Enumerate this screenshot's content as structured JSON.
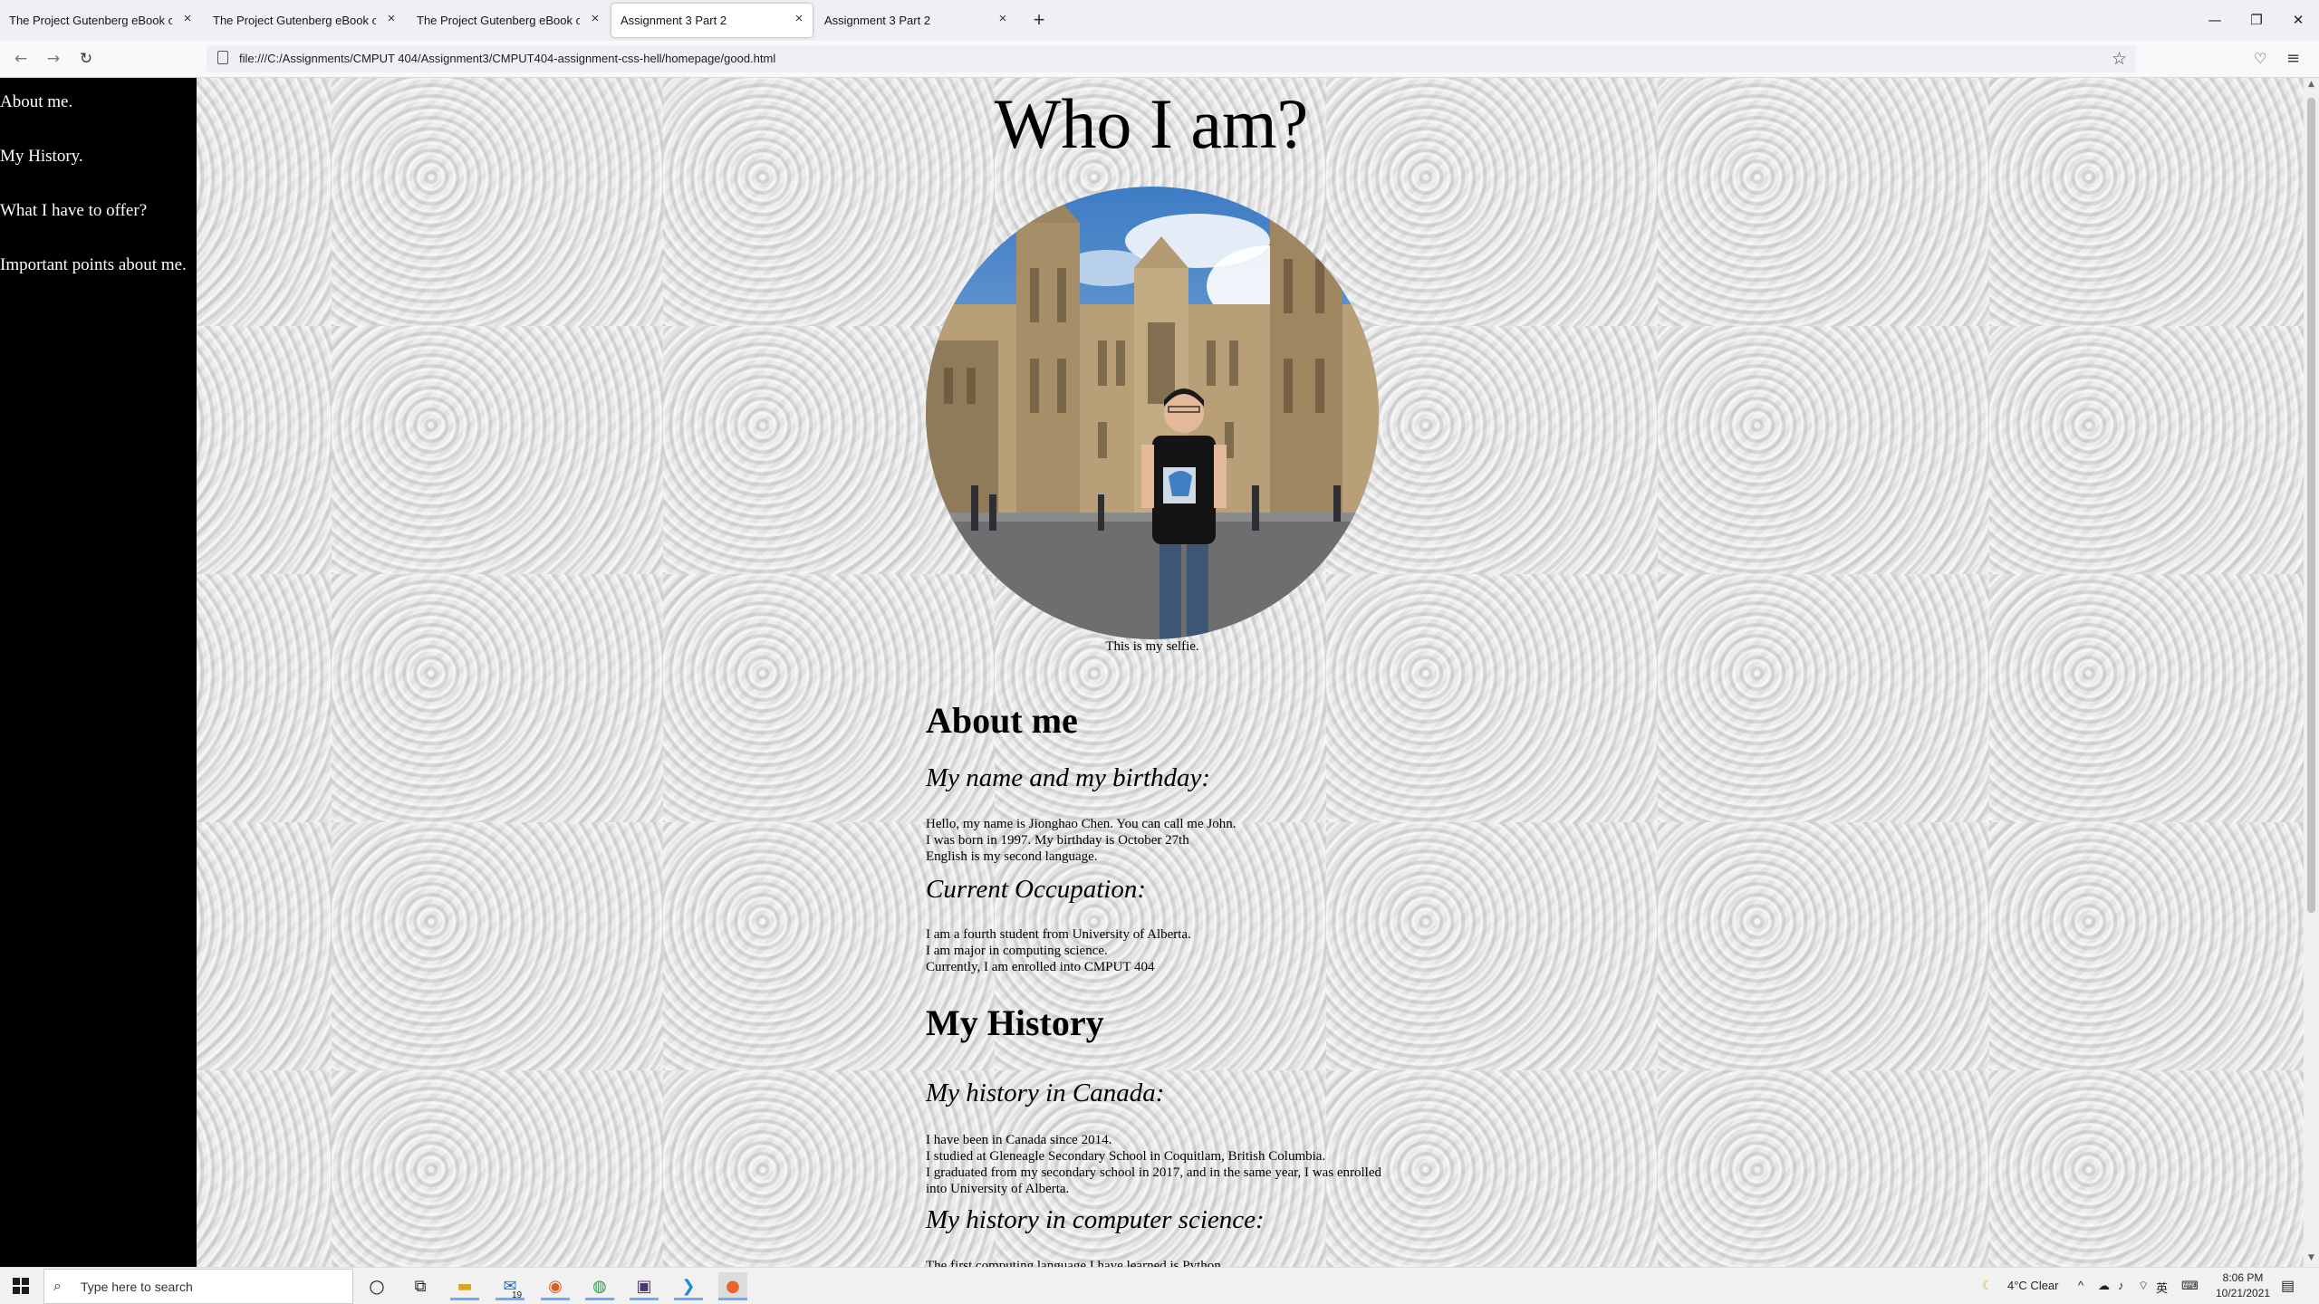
{
  "browser": {
    "tabs": [
      {
        "title": "The Project Gutenberg eBook of Fra",
        "close": "×"
      },
      {
        "title": "The Project Gutenberg eBook of Pri",
        "close": "×"
      },
      {
        "title": "The Project Gutenberg eBook of Dra",
        "close": "×"
      },
      {
        "title": "Assignment 3 Part 2",
        "close": "×"
      },
      {
        "title": "Assignment 3 Part 2",
        "close": "×"
      }
    ],
    "active_tab_index": 3,
    "new_tab_glyph": "+",
    "window_controls": {
      "minimize": "—",
      "restore": "❐",
      "close": "✕"
    },
    "nav": {
      "back": "←",
      "forward": "→",
      "reload": "↻"
    },
    "url": "file:///C:/Assignments/CMPUT 404/Assignment3/CMPUT404-assignment-css-hell/homepage/good.html",
    "icons": {
      "bookmark": "☆",
      "pocket": "♡",
      "menu": "≡"
    }
  },
  "page": {
    "sidebar": {
      "links": [
        "About me.",
        "My History.",
        "What I have to offer?",
        "Important points about me."
      ]
    },
    "title": "Who I am?",
    "selfie_caption": "This is my selfie.",
    "about": {
      "heading": "About me",
      "name_heading": "My name and my birthday:",
      "name_lines": [
        "Hello, my name is Jionghao Chen. You can call me John.",
        "I was born in 1997. My birthday is October 27th",
        "English is my second language."
      ],
      "occupation_heading": "Current Occupation:",
      "occupation_lines": [
        "I am a fourth student from University of Alberta.",
        "I am major in computing science.",
        "Currently, I am enrolled into CMPUT 404"
      ]
    },
    "history": {
      "heading": "My History",
      "canada_heading": "My history in Canada:",
      "canada_lines": [
        "I have been in Canada since 2014.",
        "I studied at Gleneagle Secondary School in Coquitlam, British Columbia.",
        "I graduated from my secondary school in 2017, and in the same year, I was enrolled into University of Alberta."
      ],
      "cs_heading": "My history in computer science:",
      "cs_lines": [
        "The first computing language I have learned is Python."
      ]
    }
  },
  "taskbar": {
    "search_placeholder": "Type here to search",
    "mail_badge": "19",
    "weather": "4°C  Clear",
    "ime": "英",
    "time": "8:06 PM",
    "date": "10/21/2021"
  }
}
